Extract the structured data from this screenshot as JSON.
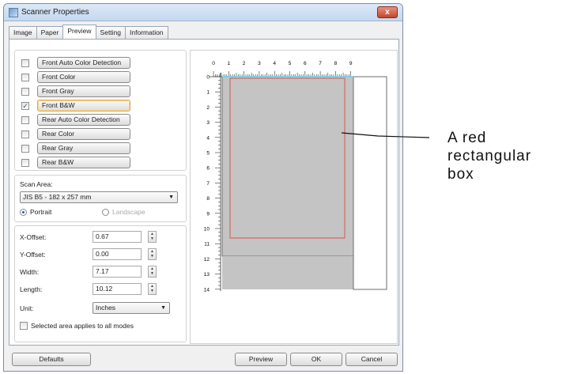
{
  "window": {
    "title": "Scanner Properties",
    "close_glyph": "x"
  },
  "tabs": [
    {
      "label": "Image"
    },
    {
      "label": "Paper"
    },
    {
      "label": "Preview",
      "active": true
    },
    {
      "label": "Setting"
    },
    {
      "label": "Information"
    }
  ],
  "modes": [
    {
      "label": "Front Auto Color Detection",
      "checked": false
    },
    {
      "label": "Front Color",
      "checked": false
    },
    {
      "label": "Front Gray",
      "checked": false
    },
    {
      "label": "Front B&W",
      "checked": true
    },
    {
      "label": "Rear Auto Color Detection",
      "checked": false
    },
    {
      "label": "Rear Color",
      "checked": false
    },
    {
      "label": "Rear Gray",
      "checked": false
    },
    {
      "label": "Rear B&W",
      "checked": false
    }
  ],
  "check_glyph": "✓",
  "scan_area": {
    "label": "Scan Area:",
    "value": "JIS B5 - 182 x 257 mm",
    "portrait": "Portrait",
    "landscape": "Landscape"
  },
  "offsets": [
    {
      "label": "X-Offset:",
      "value": "0.67"
    },
    {
      "label": "Y-Offset:",
      "value": "0.00"
    },
    {
      "label": "Width:",
      "value": "7.17"
    },
    {
      "label": "Length:",
      "value": "10.12"
    }
  ],
  "unit": {
    "label": "Unit:",
    "value": "Inches"
  },
  "apply_all": {
    "label": "Selected area applies to all modes",
    "checked": false
  },
  "ruler": {
    "h_ticks": [
      "0",
      "1",
      "2",
      "3",
      "4",
      "5",
      "6",
      "7",
      "8",
      "9"
    ],
    "v_ticks": [
      "0",
      "1",
      "2",
      "3",
      "4",
      "5",
      "6",
      "7",
      "8",
      "9",
      "10",
      "11",
      "12",
      "13",
      "14"
    ]
  },
  "buttons": {
    "defaults": "Defaults",
    "preview": "Preview",
    "ok": "OK",
    "cancel": "Cancel"
  },
  "annotation": {
    "line1": "A red",
    "line2": "rectangular",
    "line3": "box"
  },
  "colors": {
    "selection_box": "#d9534f",
    "scan_region": "#c4c4c4",
    "accent_blue": "#2c5eb0"
  }
}
